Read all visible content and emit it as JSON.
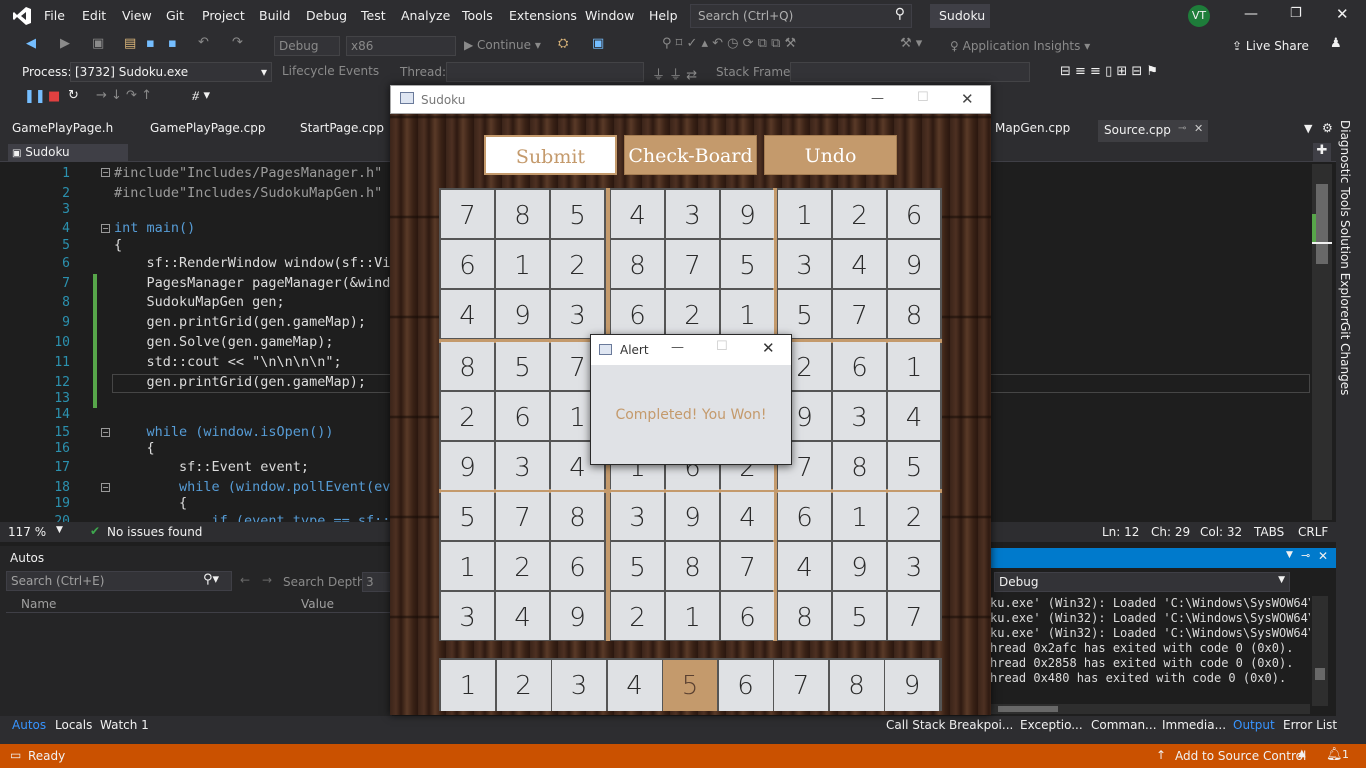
{
  "menu": {
    "items": [
      "File",
      "Edit",
      "View",
      "Git",
      "Project",
      "Build",
      "Debug",
      "Test",
      "Analyze",
      "Tools",
      "Extensions",
      "Window",
      "Help"
    ],
    "search_placeholder": "Search (Ctrl+Q)",
    "solution": "Sudoku",
    "avatar": "VT",
    "live_share": "Live Share"
  },
  "toolbar": {
    "config": "Debug",
    "platform": "x86",
    "continue": "Continue",
    "app_insights": "Application Insights",
    "process_label": "Process:",
    "process_value": "[3732] Sudoku.exe",
    "lifecycle": "Lifecycle Events",
    "thread_label": "Thread:",
    "stack_frame": "Stack Frame:"
  },
  "tabs": [
    "GamePlayPage.h",
    "GamePlayPage.cpp",
    "StartPage.cpp",
    "MapGen.cpp",
    "Source.cpp"
  ],
  "editor": {
    "nav": "Sudoku",
    "zoom": "117 %",
    "issues": "No issues found",
    "ln": "Ln: 12",
    "ch": "Ch: 29",
    "col": "Col: 32",
    "tabs": "TABS",
    "eol": "CRLF"
  },
  "code_lines": [
    {
      "n": "1",
      "t": "#include\"Includes/PagesManager.h\""
    },
    {
      "n": "2",
      "t": "#include\"Includes/SudokuMapGen.h\""
    },
    {
      "n": "3",
      "t": ""
    },
    {
      "n": "4",
      "t": "int main()"
    },
    {
      "n": "5",
      "t": "{"
    },
    {
      "n": "6",
      "t": "    sf::RenderWindow window(sf::Vi"
    },
    {
      "n": "7",
      "t": "    PagesManager pageManager(&wind"
    },
    {
      "n": "8",
      "t": "    SudokuMapGen gen;"
    },
    {
      "n": "9",
      "t": "    gen.printGrid(gen.gameMap);"
    },
    {
      "n": "10",
      "t": "    gen.Solve(gen.gameMap);"
    },
    {
      "n": "11",
      "t": "    std::cout << \"\\n\\n\\n\\n\";"
    },
    {
      "n": "12",
      "t": "    gen.printGrid(gen.gameMap);"
    },
    {
      "n": "13",
      "t": ""
    },
    {
      "n": "14",
      "t": ""
    },
    {
      "n": "15",
      "t": "    while (window.isOpen())"
    },
    {
      "n": "16",
      "t": "    {"
    },
    {
      "n": "17",
      "t": "        sf::Event event;"
    },
    {
      "n": "18",
      "t": "        while (window.pollEvent(ev"
    },
    {
      "n": "19",
      "t": "        {"
    },
    {
      "n": "20",
      "t": "            if (event.type == sf::"
    }
  ],
  "autos": {
    "title": "Autos",
    "search": "Search (Ctrl+E)",
    "depth_label": "Search Depth:",
    "depth": "3",
    "col_name": "Name",
    "col_value": "Value"
  },
  "bottom_tabs_left": [
    "Autos",
    "Locals",
    "Watch 1"
  ],
  "bottom_tabs_right": [
    "Call Stack",
    "Breakpoi...",
    "Exceptio...",
    "Comman...",
    "Immedia...",
    "Output",
    "Error List"
  ],
  "output": {
    "source": "Debug",
    "lines": [
      "ku.exe' (Win32): Loaded 'C:\\Windows\\SysWOW64\\m",
      "ku.exe' (Win32): Loaded 'C:\\Windows\\SysWOW64\\T",
      "ku.exe' (Win32): Loaded 'C:\\Windows\\SysWOW64\\c",
      "hread 0x2afc has exited with code 0 (0x0).",
      "hread 0x2858 has exited with code 0 (0x0).",
      "hread 0x480 has exited with code 0 (0x0)."
    ]
  },
  "side_tabs": [
    "Diagnostic Tools",
    "Solution Explorer",
    "Git Changes"
  ],
  "status": {
    "ready": "Ready",
    "source_control": "Add to Source Control",
    "notifications": "1"
  },
  "game": {
    "title": "Sudoku",
    "buttons": [
      "Submit",
      "Check-Board",
      "Undo"
    ],
    "board": [
      [
        "7",
        "8",
        "5",
        "4",
        "3",
        "9",
        "1",
        "2",
        "6"
      ],
      [
        "6",
        "1",
        "2",
        "8",
        "7",
        "5",
        "3",
        "4",
        "9"
      ],
      [
        "4",
        "9",
        "3",
        "6",
        "2",
        "1",
        "5",
        "7",
        "8"
      ],
      [
        "8",
        "5",
        "7",
        "",
        "",
        "",
        "2",
        "6",
        "1"
      ],
      [
        "2",
        "6",
        "1",
        "",
        "",
        "",
        "9",
        "3",
        "4"
      ],
      [
        "9",
        "3",
        "4",
        "1",
        "6",
        "2",
        "7",
        "8",
        "5"
      ],
      [
        "5",
        "7",
        "8",
        "3",
        "9",
        "4",
        "6",
        "1",
        "2"
      ],
      [
        "1",
        "2",
        "6",
        "5",
        "8",
        "7",
        "4",
        "9",
        "3"
      ],
      [
        "3",
        "4",
        "9",
        "2",
        "1",
        "6",
        "8",
        "5",
        "7"
      ]
    ],
    "palette": [
      "1",
      "2",
      "3",
      "4",
      "5",
      "6",
      "7",
      "8",
      "9"
    ],
    "palette_selected": "5"
  },
  "alert": {
    "title": "Alert",
    "message": "Completed! You Won!"
  },
  "colors": {
    "accent": "#007acc",
    "status_bar": "#ca5100",
    "game_tan": "#c49a6c",
    "cell": "#dfe1e4"
  }
}
